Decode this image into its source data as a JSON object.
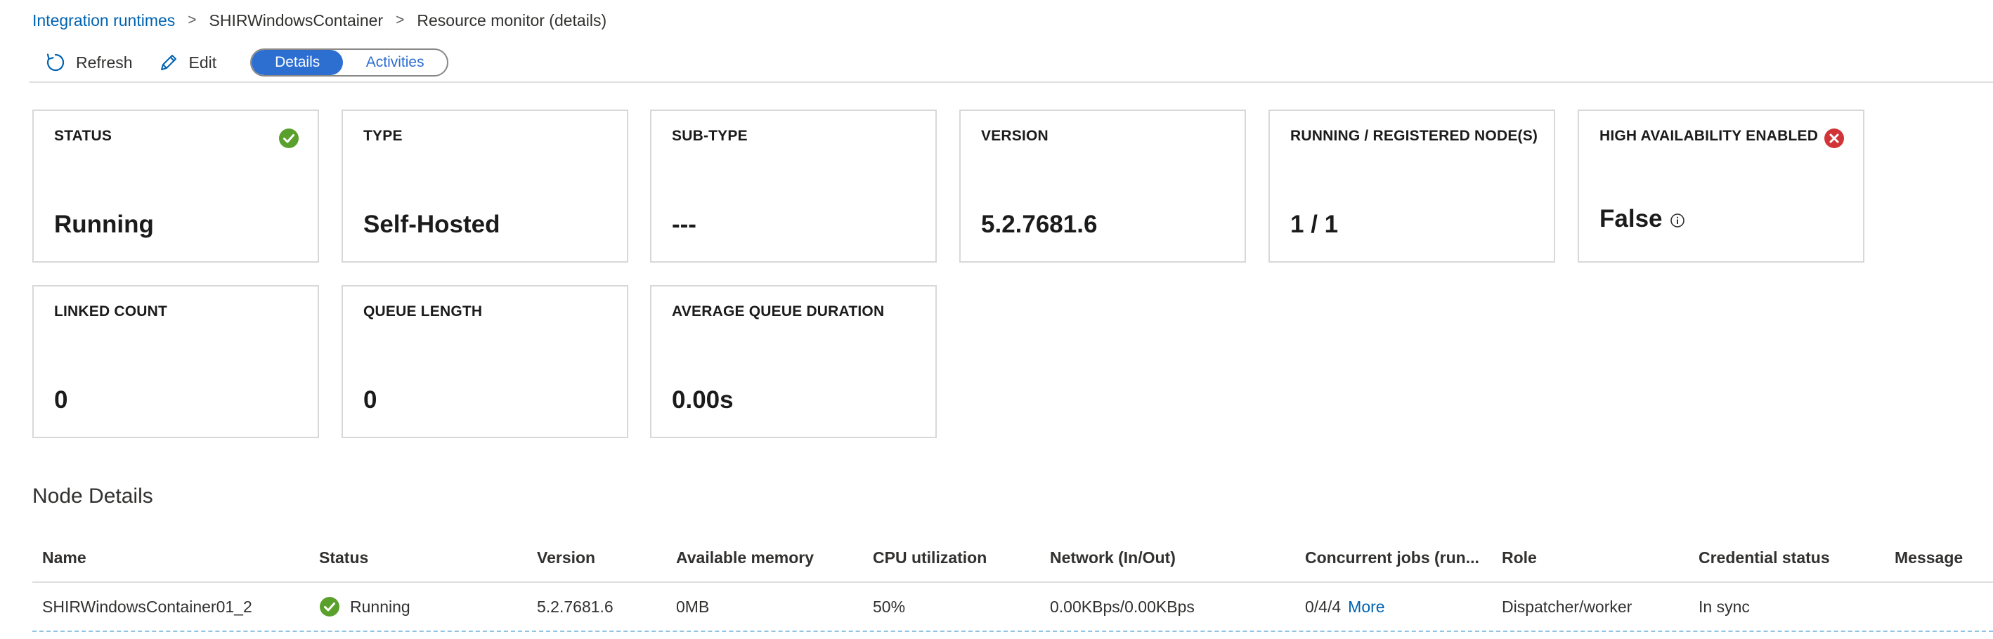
{
  "breadcrumb": {
    "items": [
      "Integration runtimes",
      "SHIRWindowsContainer",
      "Resource monitor (details)"
    ],
    "separator": ">"
  },
  "toolbar": {
    "refresh_label": "Refresh",
    "edit_label": "Edit",
    "tabs": [
      {
        "label": "Details",
        "active": true
      },
      {
        "label": "Activities",
        "active": false
      }
    ]
  },
  "cards": [
    {
      "label": "STATUS",
      "value": "Running",
      "icon": "success-check-icon"
    },
    {
      "label": "TYPE",
      "value": "Self-Hosted"
    },
    {
      "label": "SUB-TYPE",
      "value": "---"
    },
    {
      "label": "VERSION",
      "value": "5.2.7681.6"
    },
    {
      "label": "RUNNING / REGISTERED NODE(S)",
      "value": "1 / 1"
    },
    {
      "label": "HIGH AVAILABILITY ENABLED",
      "value": "False",
      "icon": "error-x-icon",
      "info_icon": "info-icon"
    },
    {
      "label": "LINKED COUNT",
      "value": "0"
    },
    {
      "label": "QUEUE LENGTH",
      "value": "0"
    },
    {
      "label": "AVERAGE QUEUE DURATION",
      "value": "0.00s"
    }
  ],
  "node_details": {
    "title": "Node Details",
    "columns": [
      "Name",
      "Status",
      "Version",
      "Available memory",
      "CPU utilization",
      "Network (In/Out)",
      "Concurrent jobs (run...",
      "Role",
      "Credential status",
      "Message"
    ],
    "rows": [
      {
        "name": "SHIRWindowsContainer01_2",
        "status": "Running",
        "version": "5.2.7681.6",
        "memory": "0MB",
        "cpu": "50%",
        "network": "0.00KBps/0.00KBps",
        "jobs": "0/4/4",
        "jobs_link": "More",
        "role": "Dispatcher/worker",
        "credential": "In sync",
        "message": ""
      }
    ]
  },
  "colors": {
    "accent": "#2d6fd1",
    "link": "#0063b1",
    "success": "#5aa02c",
    "error": "#d13438"
  }
}
